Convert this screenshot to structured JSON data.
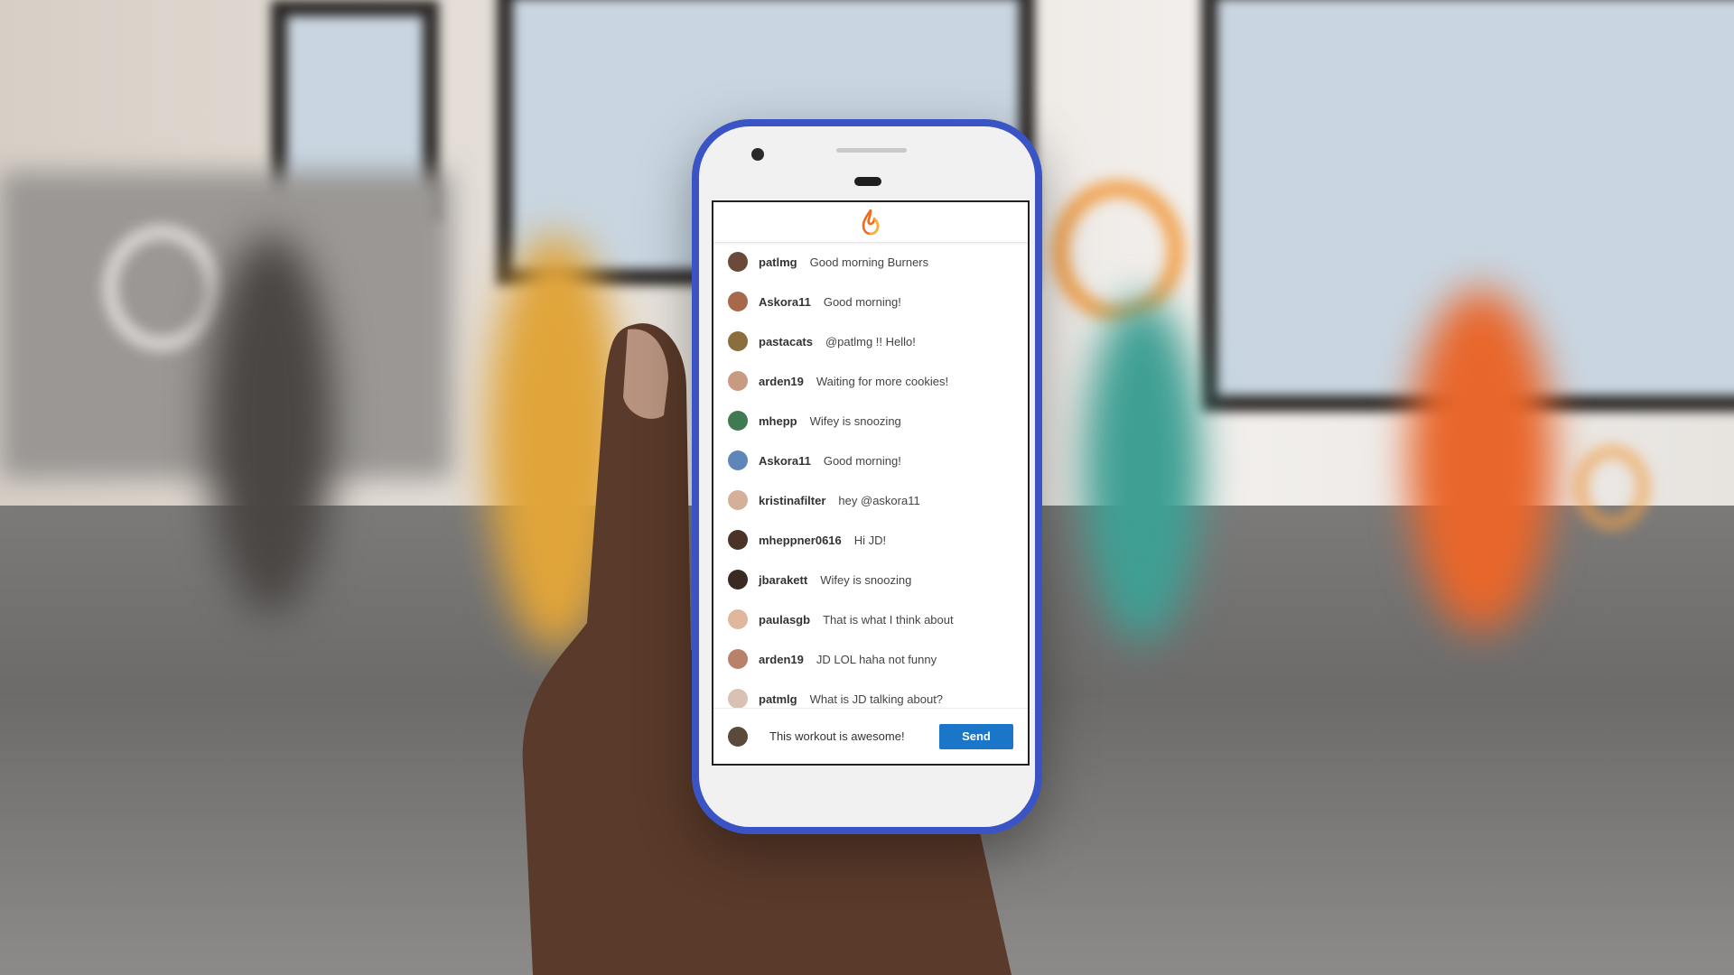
{
  "app": {
    "logo_icon": "flame-icon",
    "brand_colors": {
      "accent": "#1976c9",
      "phone_frame": "#3a54c6",
      "flame_orange": "#f06a1c",
      "flame_yellow": "#f4b03a"
    }
  },
  "chat": {
    "messages": [
      {
        "user": "patlmg",
        "text": "Good morning Burners",
        "avatar_color": "#6b4a3a"
      },
      {
        "user": "Askora11",
        "text": "Good morning!",
        "avatar_color": "#a8684b"
      },
      {
        "user": "pastacats",
        "text": "@patlmg !! Hello!",
        "avatar_color": "#8a6e3d"
      },
      {
        "user": "arden19",
        "text": "Waiting for more cookies!",
        "avatar_color": "#c99a82"
      },
      {
        "user": "mhepp",
        "text": "Wifey is snoozing",
        "avatar_color": "#3f7a52"
      },
      {
        "user": "Askora11",
        "text": "Good morning!",
        "avatar_color": "#5f86b8"
      },
      {
        "user": "kristinafilter",
        "text": "hey @askora11",
        "avatar_color": "#d4b09a"
      },
      {
        "user": "mheppner0616",
        "text": "Hi JD!",
        "avatar_color": "#4b3328"
      },
      {
        "user": "jbarakett",
        "text": "Wifey is snoozing",
        "avatar_color": "#3a2a22"
      },
      {
        "user": "paulasgb",
        "text": "That is what I think about",
        "avatar_color": "#e0b79c"
      },
      {
        "user": "arden19",
        "text": "JD LOL haha not funny",
        "avatar_color": "#b8826a"
      },
      {
        "user": "patmlg",
        "text": "What is JD talking about?",
        "avatar_color": "#d9c1b3"
      }
    ]
  },
  "composer": {
    "current_value": "This workout is awesome!",
    "avatar_color": "#5a4a3c",
    "send_label": "Send"
  }
}
